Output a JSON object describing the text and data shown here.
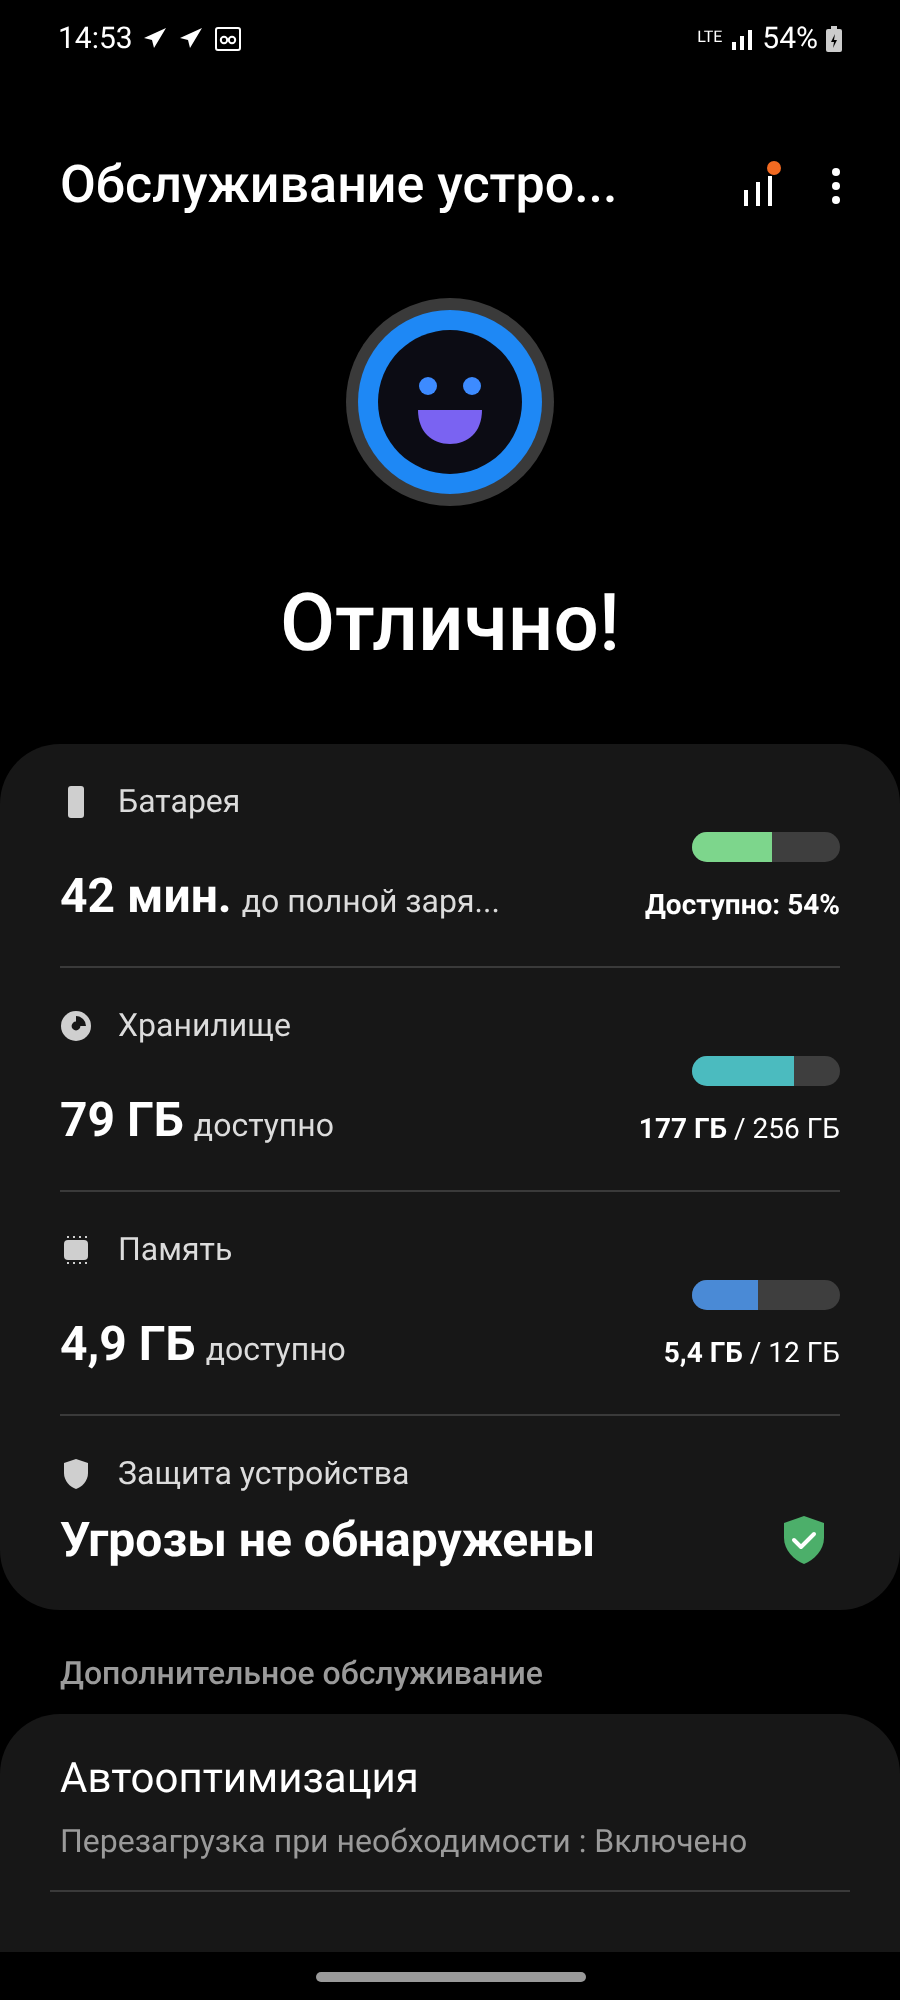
{
  "status_bar": {
    "time": "14:53",
    "network": "LTE",
    "battery": "54%"
  },
  "header": {
    "title": "Обслуживание устро..."
  },
  "hero": {
    "status": "Отлично!"
  },
  "items": [
    {
      "kind": "meter",
      "label": "Батарея",
      "value": "42 мин.",
      "suffix": "до полной заря...",
      "level": 0.54,
      "color": "#7dd68c",
      "reading": "**Доступно: 54%**"
    },
    {
      "kind": "meter",
      "label": "Хранилище",
      "value": "79 ГБ",
      "suffix": "доступно",
      "level": 0.69,
      "color": "#4bbbbf",
      "reading": "**177 ГБ** / 256 ГБ"
    },
    {
      "kind": "meter",
      "label": "Память",
      "value": "4,9 ГБ",
      "suffix": "доступно",
      "level": 0.45,
      "color": "#4a8ad6",
      "reading": "**5,4 ГБ** / 12 ГБ"
    },
    {
      "kind": "status",
      "label": "Защита устройства",
      "value": "Угрозы не обнаружены"
    }
  ],
  "section": {
    "title": "Дополнительное обслуживание"
  },
  "extra": [
    {
      "title": "Автооптимизация",
      "subtitle": "Перезагрузка при необходимости : Включено"
    }
  ]
}
